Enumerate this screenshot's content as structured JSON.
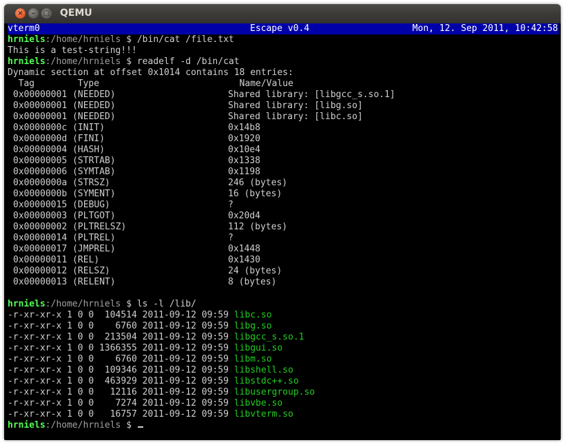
{
  "window": {
    "title": "QEMU"
  },
  "statusbar": {
    "left": "vterm0",
    "center": "Escape v0.4",
    "right": "Mon, 12. Sep 2011, 10:42:58"
  },
  "prompt": {
    "user": "hrniels",
    "path": ":/home/hrniels",
    "symbol": " $ "
  },
  "commands": {
    "cat": "/bin/cat /file.txt",
    "readelf": "readelf -d /bin/cat",
    "ls": "ls -l /lib/",
    "current": ""
  },
  "cat_output": "This is a test-string!!!",
  "readelf": {
    "header": "Dynamic section at offset 0x1014 contains 18 entries:",
    "col_header": "  Tag        Type                          Name/Value",
    "entries": [
      {
        "tag": "0x00000001 (NEEDED)",
        "value": "Shared library: [libgcc_s.so.1]"
      },
      {
        "tag": "0x00000001 (NEEDED)",
        "value": "Shared library: [libg.so]"
      },
      {
        "tag": "0x00000001 (NEEDED)",
        "value": "Shared library: [libc.so]"
      },
      {
        "tag": "0x0000000c (INIT)",
        "value": "0x14b8"
      },
      {
        "tag": "0x0000000d (FINI)",
        "value": "0x1920"
      },
      {
        "tag": "0x00000004 (HASH)",
        "value": "0x10e4"
      },
      {
        "tag": "0x00000005 (STRTAB)",
        "value": "0x1338"
      },
      {
        "tag": "0x00000006 (SYMTAB)",
        "value": "0x1198"
      },
      {
        "tag": "0x0000000a (STRSZ)",
        "value": "246 (bytes)"
      },
      {
        "tag": "0x0000000b (SYMENT)",
        "value": "16 (bytes)"
      },
      {
        "tag": "0x00000015 (DEBUG)",
        "value": "?"
      },
      {
        "tag": "0x00000003 (PLTGOT)",
        "value": "0x20d4"
      },
      {
        "tag": "0x00000002 (PLTRELSZ)",
        "value": "112 (bytes)"
      },
      {
        "tag": "0x00000014 (PLTREL)",
        "value": "?"
      },
      {
        "tag": "0x00000017 (JMPREL)",
        "value": "0x1448"
      },
      {
        "tag": "0x00000011 (REL)",
        "value": "0x1430"
      },
      {
        "tag": "0x00000012 (RELSZ)",
        "value": "24 (bytes)"
      },
      {
        "tag": "0x00000013 (RELENT)",
        "value": "8 (bytes)"
      }
    ]
  },
  "ls_entries": [
    {
      "info": "-r-xr-xr-x 1 0 0  104514 2011-09-12 09:59 ",
      "name": "libc.so"
    },
    {
      "info": "-r-xr-xr-x 1 0 0    6760 2011-09-12 09:59 ",
      "name": "libg.so"
    },
    {
      "info": "-r-xr-xr-x 1 0 0  213504 2011-09-12 09:59 ",
      "name": "libgcc_s.so.1"
    },
    {
      "info": "-r-xr-xr-x 1 0 0 1366355 2011-09-12 09:59 ",
      "name": "libgui.so"
    },
    {
      "info": "-r-xr-xr-x 1 0 0    6760 2011-09-12 09:59 ",
      "name": "libm.so"
    },
    {
      "info": "-r-xr-xr-x 1 0 0  109346 2011-09-12 09:59 ",
      "name": "libshell.so"
    },
    {
      "info": "-r-xr-xr-x 1 0 0  463929 2011-09-12 09:59 ",
      "name": "libstdc++.so"
    },
    {
      "info": "-r-xr-xr-x 1 0 0   12116 2011-09-12 09:59 ",
      "name": "libusergroup.so"
    },
    {
      "info": "-r-xr-xr-x 1 0 0    7274 2011-09-12 09:59 ",
      "name": "libvbe.so"
    },
    {
      "info": "-r-xr-xr-x 1 0 0   16757 2011-09-12 09:59 ",
      "name": "libvterm.so"
    }
  ],
  "colors": {
    "statusbar_bg": "#0000a8",
    "user": "#55ff55",
    "path": "#a0a0a0",
    "file": "#22cc22",
    "text": "#d0d0d0"
  }
}
